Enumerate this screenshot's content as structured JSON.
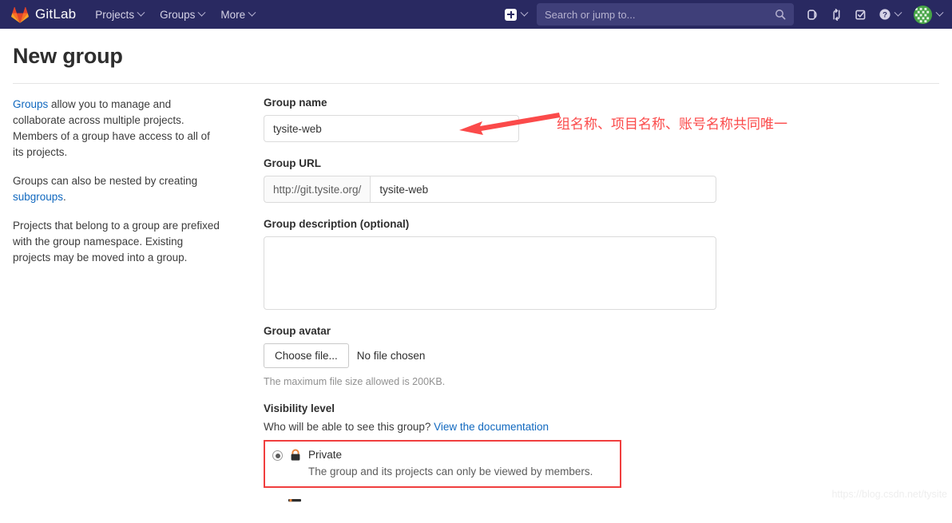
{
  "navbar": {
    "brand": "GitLab",
    "logo_icon": "gitlab-tanuki-icon",
    "links": [
      {
        "label": "Projects",
        "icon": "chevron-down-icon"
      },
      {
        "label": "Groups",
        "icon": "chevron-down-icon"
      },
      {
        "label": "More",
        "icon": "chevron-down-icon"
      }
    ],
    "create_new": {
      "icon": "plus-square-icon",
      "caret": "chevron-down-icon"
    },
    "search": {
      "placeholder": "Search or jump to...",
      "value": "",
      "icon": "search-icon"
    },
    "icons": [
      {
        "name": "issues-icon"
      },
      {
        "name": "merge-requests-icon"
      },
      {
        "name": "todos-icon"
      }
    ],
    "help": {
      "icon": "question-circle-icon",
      "caret": "chevron-down-icon"
    },
    "user": {
      "icon": "user-avatar-identicon",
      "caret": "chevron-down-icon"
    },
    "background_color": "#292961"
  },
  "page": {
    "title": "New group"
  },
  "sidebar": {
    "paragraphs": [
      {
        "link": "Groups",
        "rest": " allow you to manage and collaborate across multiple projects. Members of a group have access to all of its projects."
      },
      {
        "pre": "Groups can also be nested by creating ",
        "link": "subgroups",
        "rest": "."
      },
      {
        "text": "Projects that belong to a group are prefixed with the group namespace. Existing projects may be moved into a group."
      }
    ]
  },
  "form": {
    "group_name": {
      "label": "Group name",
      "value": "tysite-web",
      "placeholder": ""
    },
    "group_url": {
      "label": "Group URL",
      "prefix": "http://git.tysite.org/",
      "value": "tysite-web",
      "placeholder": ""
    },
    "group_description": {
      "label": "Group description (optional)",
      "value": "",
      "placeholder": ""
    },
    "group_avatar": {
      "label": "Group avatar",
      "choose_button": "Choose file...",
      "file_status": "No file chosen",
      "help_text": "The maximum file size allowed is 200KB."
    },
    "visibility": {
      "label": "Visibility level",
      "question": "Who will be able to see this group?",
      "doc_link": "View the documentation",
      "options": [
        {
          "title": "Private",
          "description": "The group and its projects can only be viewed by members.",
          "icon": "lock-icon",
          "selected": true
        }
      ]
    }
  },
  "annotation": {
    "text": "组名称、项目名称、账号名称共同唯一",
    "color": "#fb4a4a",
    "arrow_icon": "left-arrow-icon",
    "highlight_color": "#f03e3e"
  },
  "watermark": {
    "text": "https://blog.csdn.net/tysite"
  }
}
